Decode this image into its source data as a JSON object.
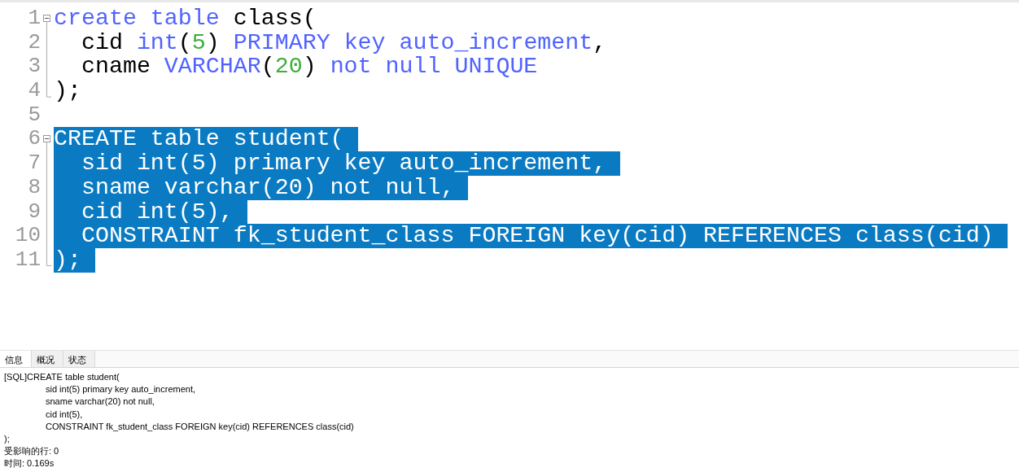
{
  "editor": {
    "blocks": [
      {
        "collapsible": true,
        "lines": [
          {
            "number": "1",
            "selected": false,
            "tokens": [
              {
                "text": "create table ",
                "kind": "keyword"
              },
              {
                "text": "class(",
                "kind": "plain"
              }
            ]
          },
          {
            "number": "2",
            "selected": false,
            "indent": true,
            "tokens": [
              {
                "text": "cid ",
                "kind": "plain"
              },
              {
                "text": "int",
                "kind": "keyword"
              },
              {
                "text": "(",
                "kind": "plain"
              },
              {
                "text": "5",
                "kind": "number"
              },
              {
                "text": ") ",
                "kind": "plain"
              },
              {
                "text": "PRIMARY key auto_increment",
                "kind": "keyword"
              },
              {
                "text": ",",
                "kind": "plain"
              }
            ]
          },
          {
            "number": "3",
            "selected": false,
            "indent": true,
            "tokens": [
              {
                "text": "cname ",
                "kind": "plain"
              },
              {
                "text": "VARCHAR",
                "kind": "keyword"
              },
              {
                "text": "(",
                "kind": "plain"
              },
              {
                "text": "20",
                "kind": "number"
              },
              {
                "text": ") ",
                "kind": "plain"
              },
              {
                "text": "not null UNIQUE",
                "kind": "keyword"
              }
            ]
          },
          {
            "number": "4",
            "selected": false,
            "tokens": [
              {
                "text": ");",
                "kind": "plain"
              }
            ]
          }
        ]
      },
      {
        "collapsible": false,
        "lines": [
          {
            "number": "5"
          }
        ]
      },
      {
        "collapsible": true,
        "lines": [
          {
            "number": "6",
            "selected": true,
            "tokens": [
              {
                "text": "CREATE table student(",
                "kind": "plain"
              }
            ]
          },
          {
            "number": "7",
            "selected": true,
            "indent": true,
            "tokens": [
              {
                "text": "sid int(5) primary key auto_increment,",
                "kind": "plain"
              }
            ]
          },
          {
            "number": "8",
            "selected": true,
            "indent": true,
            "tokens": [
              {
                "text": "sname varchar(20) not null,",
                "kind": "plain"
              }
            ]
          },
          {
            "number": "9",
            "selected": true,
            "indent": true,
            "tokens": [
              {
                "text": "cid int(5),",
                "kind": "plain"
              }
            ]
          },
          {
            "number": "10",
            "selected": true,
            "indent": true,
            "tokens": [
              {
                "text": "CONSTRAINT fk_student_class FOREIGN key(cid) REFERENCES class(cid)",
                "kind": "plain"
              }
            ]
          },
          {
            "number": "11",
            "selected": true,
            "tokens": [
              {
                "text": ");",
                "kind": "plain"
              }
            ]
          }
        ]
      }
    ]
  },
  "result_panel": {
    "tabs": [
      {
        "label": "信息",
        "selected": true
      },
      {
        "label": "概况",
        "selected": false
      },
      {
        "label": "状态",
        "selected": false
      }
    ],
    "messages": [
      {
        "text": "[SQL]CREATE table student(",
        "indented": false
      },
      {
        "text": "sid int(5) primary key auto_increment,",
        "indented": true
      },
      {
        "text": "sname varchar(20) not null,",
        "indented": true
      },
      {
        "text": "cid int(5),",
        "indented": true
      },
      {
        "text": "CONSTRAINT fk_student_class FOREIGN key(cid) REFERENCES class(cid)",
        "indented": true
      },
      {
        "text": ");",
        "indented": false
      },
      {
        "text": "受影响的行: 0",
        "indented": false
      },
      {
        "text": "时间: 0.169s",
        "indented": false
      }
    ]
  }
}
